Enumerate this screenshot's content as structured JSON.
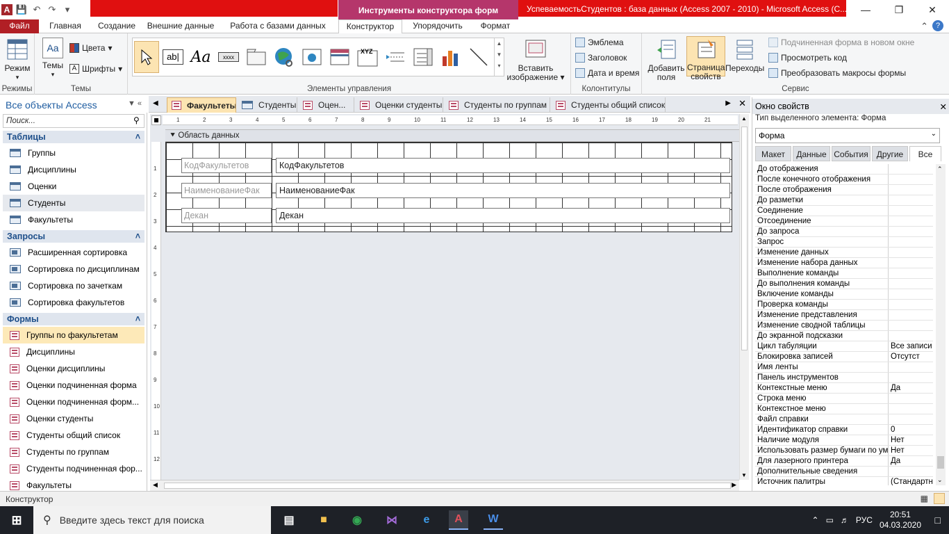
{
  "titlebar": {
    "context_title": "Инструменты конструктора форм",
    "app_title": "УспеваемостьСтудентов : база данных (Access 2007 - 2010) - Microsoft Access (С..."
  },
  "ribbon_tabs": [
    "Файл",
    "Главная",
    "Создание",
    "Внешние данные",
    "Работа с базами данных",
    "Конструктор",
    "Упорядочить",
    "Формат"
  ],
  "ribbon": {
    "views_label": "Режим",
    "views_group": "Режимы",
    "themes_label": "Темы",
    "colors_label": "Цвета",
    "fonts_label": "Шрифты",
    "themes_group": "Темы",
    "controls_group": "Элементы управления",
    "insert_image": "Вставить изображение",
    "logo": "Эмблема",
    "header_title": "Заголовок",
    "date_time": "Дата и время",
    "header_group": "Колонтитулы",
    "add_fields": "Добавить поля",
    "property_sheet": "Страница свойств",
    "tab_order": "Переходы",
    "subform_new_window": "Подчиненная форма в новом окне",
    "view_code": "Просмотреть код",
    "convert_macros": "Преобразовать макросы формы",
    "tools_group": "Сервис"
  },
  "nav": {
    "title": "Все объекты Access",
    "search_placeholder": "Поиск...",
    "sections": [
      {
        "name": "Таблицы",
        "items": [
          "Группы",
          "Дисциплины",
          "Оценки",
          "Студенты",
          "Факультеты"
        ]
      },
      {
        "name": "Запросы",
        "items": [
          "Расширенная сортировка",
          "Сортировка по дисциплинам",
          "Сортировка по зачеткам",
          "Сортировка факультетов"
        ]
      },
      {
        "name": "Формы",
        "items": [
          "Группы по факультетам",
          "Дисциплины",
          "Оценки дисциплины",
          "Оценки подчиненная форма",
          "Оценки подчиненная форм...",
          "Оценки студенты",
          "Студенты общий список",
          "Студенты по группам",
          "Студенты подчиненная фор...",
          "Факультеты"
        ]
      }
    ]
  },
  "doc_tabs": [
    "Факультеты",
    "Студенты",
    "Оцен...",
    "Оценки студенты",
    "Студенты по группам",
    "Студенты общий список"
  ],
  "designer": {
    "section": "Область данных",
    "labels": [
      "КодФакультетов",
      "НаименованиеФак",
      "Декан"
    ],
    "fields": [
      "КодФакультетов",
      "НаименованиеФак",
      "Декан"
    ],
    "ruler_h": [
      "1",
      "2",
      "3",
      "4",
      "5",
      "6",
      "7",
      "8",
      "9",
      "10",
      "11",
      "12",
      "13",
      "14",
      "15",
      "16",
      "17",
      "18",
      "19",
      "20",
      "21"
    ],
    "ruler_v": [
      "1",
      "2",
      "3",
      "4",
      "5",
      "6",
      "7",
      "8",
      "9",
      "10",
      "11",
      "12"
    ]
  },
  "props": {
    "title": "Окно свойств",
    "seltype": "Тип выделенного элемента:  Форма",
    "selected": "Форма",
    "tabs": [
      "Макет",
      "Данные",
      "События",
      "Другие",
      "Все"
    ],
    "rows": [
      [
        "До отображения",
        ""
      ],
      [
        "После конечного отображения",
        ""
      ],
      [
        "После отображения",
        ""
      ],
      [
        "До разметки",
        ""
      ],
      [
        "Соединение",
        ""
      ],
      [
        "Отсоединение",
        ""
      ],
      [
        "До запроса",
        ""
      ],
      [
        "Запрос",
        ""
      ],
      [
        "Изменение данных",
        ""
      ],
      [
        "Изменение набора данных",
        ""
      ],
      [
        "Выполнение команды",
        ""
      ],
      [
        "До выполнения команды",
        ""
      ],
      [
        "Включение команды",
        ""
      ],
      [
        "Проверка команды",
        ""
      ],
      [
        "Изменение представления",
        ""
      ],
      [
        "Изменение сводной таблицы",
        ""
      ],
      [
        "До экранной подсказки",
        ""
      ],
      [
        "Цикл табуляции",
        "Все записи"
      ],
      [
        "Блокировка записей",
        "Отсутст"
      ],
      [
        "Имя ленты",
        ""
      ],
      [
        "Панель инструментов",
        ""
      ],
      [
        "Контекстные меню",
        "Да"
      ],
      [
        "Строка меню",
        ""
      ],
      [
        "Контекстное меню",
        ""
      ],
      [
        "Файл справки",
        ""
      ],
      [
        "Идентификатор справки",
        "0"
      ],
      [
        "Наличие модуля",
        "Нет"
      ],
      [
        "Использовать размер бумаги по ум",
        "Нет"
      ],
      [
        "Для лазерного принтера",
        "Да"
      ],
      [
        "Дополнительные сведения",
        ""
      ],
      [
        "Источник палитры",
        "(Стандартн"
      ]
    ]
  },
  "status": "Конструктор",
  "taskbar": {
    "search": "Введите здесь текст для поиска",
    "lang": "РУС",
    "time": "20:51",
    "date": "04.03.2020"
  }
}
